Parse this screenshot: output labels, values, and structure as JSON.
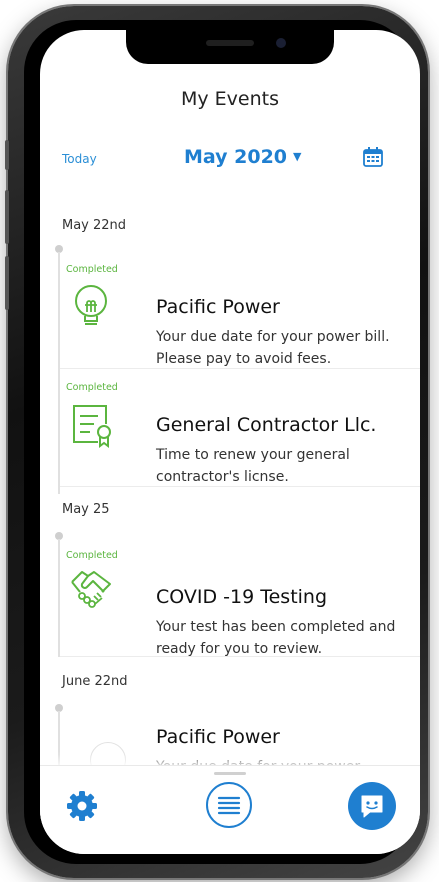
{
  "header": {
    "title": "My Events",
    "today_label": "Today",
    "month_label": "May  2020",
    "caret": "▼"
  },
  "groups": [
    {
      "date": "May 22nd",
      "events": [
        {
          "status": "Completed",
          "icon": "lightbulb-icon",
          "title": "Pacific Power",
          "description": "Your due date for your power bill. Please pay to avoid fees."
        },
        {
          "status": "Completed",
          "icon": "certificate-icon",
          "title": "General Contractor Llc.",
          "description": "Time to renew your general contractor's licnse."
        }
      ]
    },
    {
      "date": "May 25",
      "events": [
        {
          "status": "Completed",
          "icon": "handshake-icon",
          "title": "COVID -19 Testing",
          "description": "Your test has been completed and ready for you to review."
        }
      ]
    },
    {
      "date": "June 22nd",
      "events": [
        {
          "status": "",
          "icon": "lightbulb-icon",
          "title": "Pacific Power",
          "description": "Your due date for your power"
        }
      ]
    }
  ],
  "bottom_nav": {
    "settings_icon": "gear-icon",
    "menu_icon": "list-menu-icon",
    "chat_icon": "chat-icon"
  },
  "colors": {
    "accent": "#1f7fd0",
    "completed": "#5bb53f",
    "timeline": "#e0e0e0"
  }
}
